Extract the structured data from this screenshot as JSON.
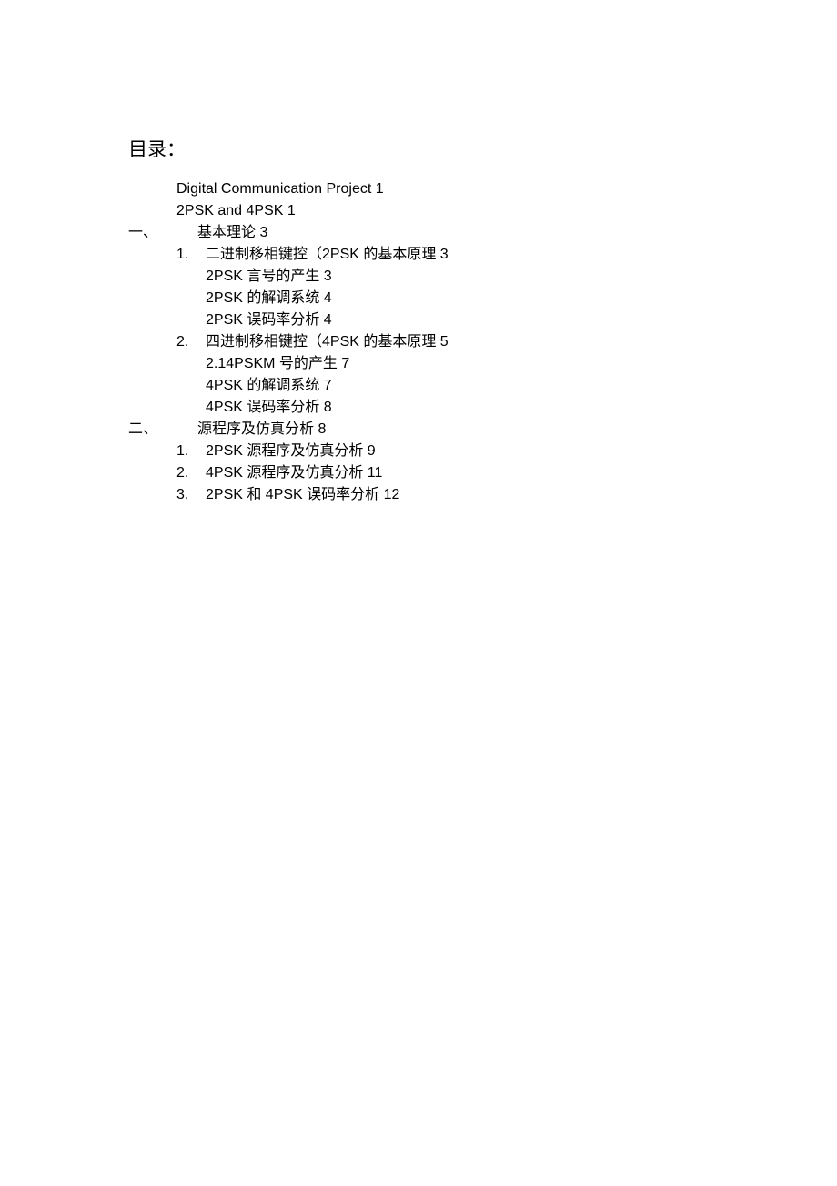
{
  "title": "目录：",
  "entries": [
    {
      "type": "pre",
      "text": "Digital Communication Project 1"
    },
    {
      "type": "pre",
      "text": "2PSK and 4PSK 1"
    },
    {
      "type": "section",
      "marker": "一、",
      "text": "基本理论 3"
    },
    {
      "type": "num",
      "marker": "1.",
      "text": "二进制移相键控（2PSK 的基本原理 3"
    },
    {
      "type": "sub",
      "text": "2PSK 言号的产生 3"
    },
    {
      "type": "sub",
      "text": "2PSK 的解调系统 4"
    },
    {
      "type": "sub",
      "text": "2PSK 误码率分析 4"
    },
    {
      "type": "num",
      "marker": "2.",
      "text": "四进制移相键控（4PSK 的基本原理  5"
    },
    {
      "type": "sub",
      "text": "2.14PSKM 号的产生 7"
    },
    {
      "type": "sub",
      "text": "4PSK 的解调系统 7"
    },
    {
      "type": "sub",
      "text": "4PSK 误码率分析  8"
    },
    {
      "type": "section",
      "marker": "二、",
      "text": "源程序及仿真分析 8"
    },
    {
      "type": "num",
      "marker": "1.",
      "text": "2PSK 源程序及仿真分析  9"
    },
    {
      "type": "num",
      "marker": "2.",
      "text": "4PSK 源程序及仿真分析  11"
    },
    {
      "type": "num",
      "marker": "3.",
      "text": "2PSK 和 4PSK 误码率分析 12"
    }
  ]
}
